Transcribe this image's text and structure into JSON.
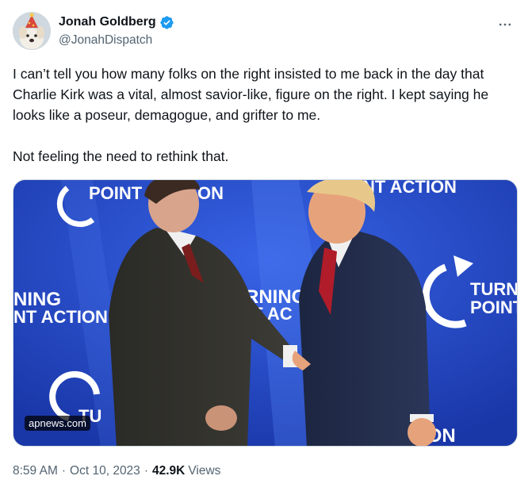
{
  "author": {
    "display_name": "Jonah Goldberg",
    "handle": "@JonahDispatch",
    "verified": true,
    "avatar_icon": "dog-with-party-hat-avatar"
  },
  "more_icon": "ellipsis-icon",
  "tweet": {
    "text": "I can’t tell you how many folks on the right insisted to me back in the day that Charlie Kirk was a vital, almost savior-like, figure on the right. I kept saying he looks like a poseur, demagogue, and grifter to me.\n\nNot feeling the need to rethink that."
  },
  "media": {
    "source_label": "apnews.com",
    "backdrop_texts": [
      "POINT",
      "ON",
      "NT ACTION",
      "NING",
      "NT ACTION",
      "TURNING",
      "OINT AC",
      "TURNI",
      "POINT",
      "TU",
      "ION"
    ]
  },
  "meta": {
    "time": "8:59 AM",
    "separator": "·",
    "date": "Oct 10, 2023",
    "views_count": "42.9K",
    "views_label": "Views"
  },
  "colors": {
    "verified_badge": "#1d9bf0",
    "secondary_text": "#536471",
    "backdrop_blue": "#1d3fb2"
  }
}
